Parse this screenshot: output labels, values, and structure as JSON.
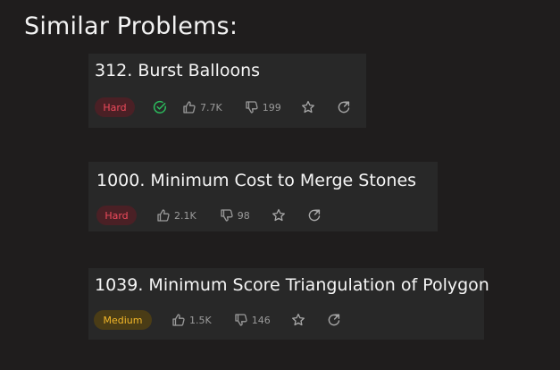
{
  "page": {
    "title": "Similar Problems:"
  },
  "problems": [
    {
      "title": "312. Burst Balloons",
      "difficulty": "Hard",
      "solved": true,
      "likes": "7.7K",
      "dislikes": "199",
      "icons": {
        "solved": "check-circle-icon",
        "like": "thumbs-up-icon",
        "dislike": "thumbs-down-icon",
        "favorite": "star-icon",
        "share": "refresh-share-icon"
      }
    },
    {
      "title": "1000. Minimum Cost to Merge Stones",
      "difficulty": "Hard",
      "solved": false,
      "likes": "2.1K",
      "dislikes": "98",
      "icons": {
        "like": "thumbs-up-icon",
        "dislike": "thumbs-down-icon",
        "favorite": "star-icon",
        "share": "refresh-share-icon"
      }
    },
    {
      "title": "1039. Minimum Score Triangulation of Polygon",
      "difficulty": "Medium",
      "solved": false,
      "likes": "1.5K",
      "dislikes": "146",
      "icons": {
        "like": "thumbs-up-icon",
        "dislike": "thumbs-down-icon",
        "favorite": "star-icon",
        "share": "refresh-share-icon"
      }
    }
  ],
  "colors": {
    "background": "#1f1d1d",
    "card": "#282828",
    "hard_text": "#ef4a5c",
    "hard_bg": "#4a2025",
    "medium_text": "#f4b829",
    "medium_bg": "#4a3c16",
    "solved_check": "#2cbb5d"
  }
}
